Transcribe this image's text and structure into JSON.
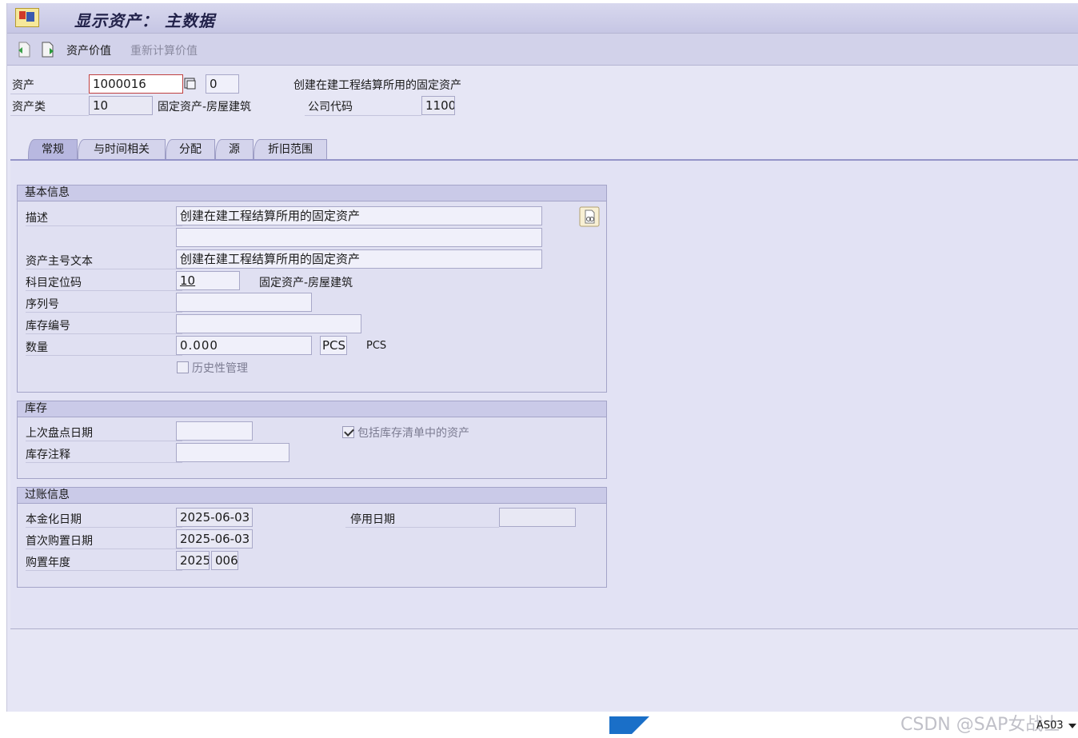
{
  "window": {
    "title": "显示资产： 主数据"
  },
  "toolbar": {
    "asset_values": "资产价值",
    "recalc_values": "重新计算价值"
  },
  "header": {
    "asset_label": "资产",
    "asset_number": "1000016",
    "sub_number": "0",
    "asset_description": "创建在建工程结算所用的固定资产",
    "asset_class_label": "资产类",
    "asset_class": "10",
    "asset_class_text": "固定资产-房屋建筑",
    "company_code_label": "公司代码",
    "company_code": "1100"
  },
  "tabs": [
    {
      "label": "常规"
    },
    {
      "label": "与时间相关"
    },
    {
      "label": "分配"
    },
    {
      "label": "源"
    },
    {
      "label": "折旧范围"
    }
  ],
  "general": {
    "title": "基本信息",
    "description_label": "描述",
    "description_1": "创建在建工程结算所用的固定资产",
    "description_2": "",
    "main_text_label": "资产主号文本",
    "main_text": "创建在建工程结算所用的固定资产",
    "account_det_label": "科目定位码",
    "account_det": "10",
    "account_det_text": "固定资产-房屋建筑",
    "serial_label": "序列号",
    "serial": "",
    "inventory_no_label": "库存编号",
    "inventory_no": "",
    "quantity_label": "数量",
    "quantity": "0.000",
    "unit": "PCS",
    "unit_text": "PCS",
    "history_label": "历史性管理"
  },
  "inventory": {
    "title": "库存",
    "last_inv_date_label": "上次盘点日期",
    "last_inv_date": "",
    "include_label": "包括库存清单中的资产",
    "note_label": "库存注释",
    "note": ""
  },
  "posting": {
    "title": "过账信息",
    "cap_date_label": "本金化日期",
    "cap_date": "2025-06-03",
    "deact_label": "停用日期",
    "deact_date": "",
    "first_acq_label": "首次购置日期",
    "first_acq": "2025-06-03",
    "acq_year_label": "购置年度",
    "acq_year": "2025",
    "acq_period": "006"
  },
  "status": {
    "system": "AS03",
    "watermark": "CSDN @SAP女战士"
  },
  "colors": {
    "background": "#e6e6f5",
    "tab_active": "#b8b8e0",
    "group_head": "#cacae8"
  }
}
